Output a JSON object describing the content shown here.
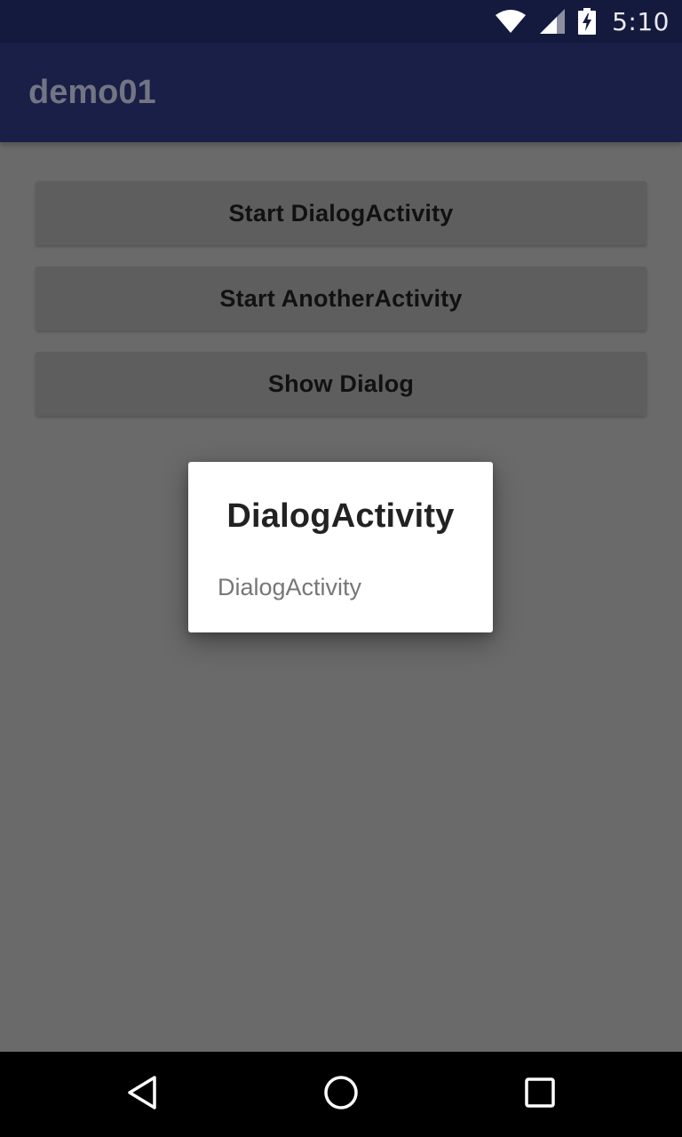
{
  "status_bar": {
    "time": "5:10",
    "icons": [
      "wifi-icon",
      "cell-signal-icon",
      "battery-charging-icon"
    ]
  },
  "app_bar": {
    "title": "demo01"
  },
  "main": {
    "buttons": [
      {
        "label": "Start DialogActivity"
      },
      {
        "label": "Start AnotherActivity"
      },
      {
        "label": "Show Dialog"
      }
    ]
  },
  "dialog": {
    "title": "DialogActivity",
    "message": "DialogActivity"
  },
  "nav_bar": {
    "icons": [
      "back-icon",
      "home-icon",
      "recents-icon"
    ]
  },
  "colors": {
    "status_bar": "#141a3e",
    "app_bar": "#1a1f48",
    "scrim_background": "#6a6a6a",
    "button": "#5e5e5e",
    "dialog": "#ffffff"
  }
}
